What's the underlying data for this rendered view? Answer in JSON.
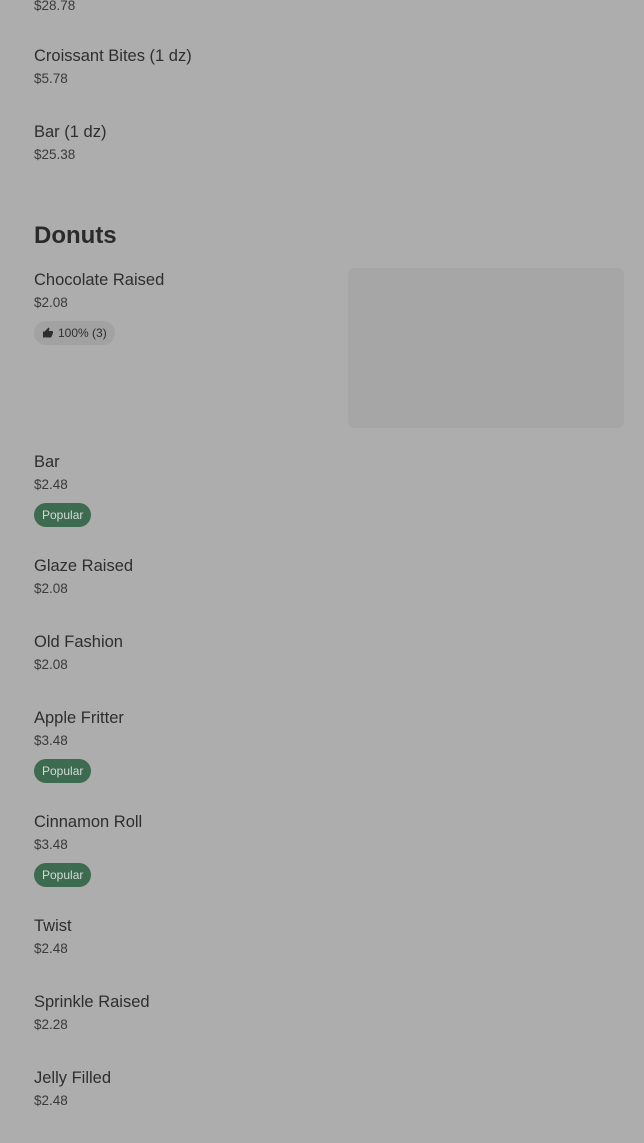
{
  "top_price": "$28.78",
  "pre_items": [
    {
      "name": "Croissant Bites (1 dz)",
      "price": "$5.78"
    },
    {
      "name": "Bar (1 dz)",
      "price": "$25.38"
    }
  ],
  "section": {
    "title": "Donuts"
  },
  "donuts": [
    {
      "name": "Chocolate Raised",
      "price": "$2.08",
      "rating": "100% (3)"
    },
    {
      "name": "Bar",
      "price": "$2.48",
      "badge": "Popular"
    },
    {
      "name": "Glaze Raised",
      "price": "$2.08"
    },
    {
      "name": "Old Fashion",
      "price": "$2.08"
    },
    {
      "name": "Apple Fritter",
      "price": "$3.48",
      "badge": "Popular"
    },
    {
      "name": "Cinnamon Roll",
      "price": "$3.48",
      "badge": "Popular"
    },
    {
      "name": "Twist",
      "price": "$2.48"
    },
    {
      "name": "Sprinkle Raised",
      "price": "$2.28"
    },
    {
      "name": "Jelly Filled",
      "price": "$2.48"
    }
  ],
  "icons": {
    "rating": "thumbs-up-icon"
  },
  "colors": {
    "overlay_bg": "#adadad",
    "popular_badge": "#3d6b4f"
  }
}
